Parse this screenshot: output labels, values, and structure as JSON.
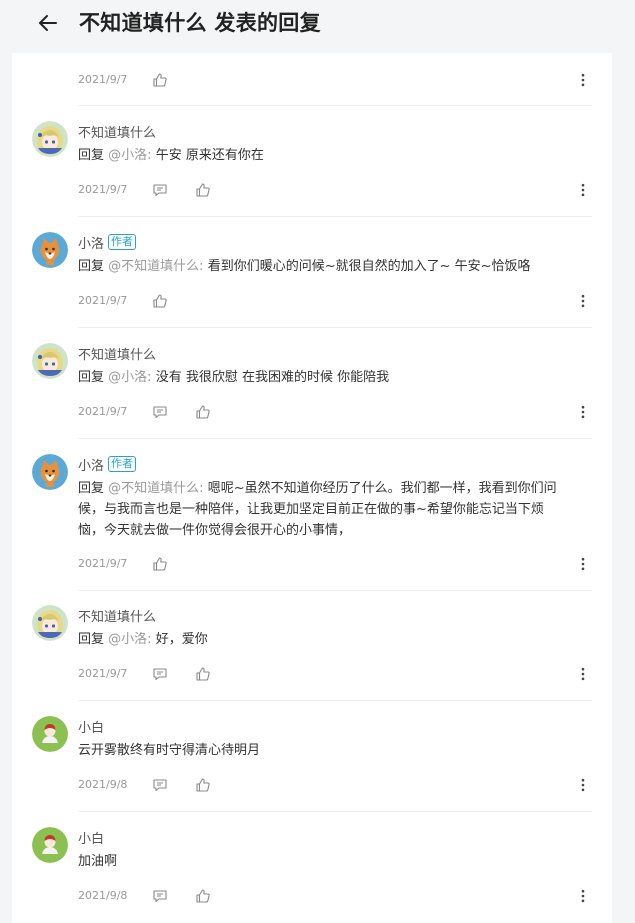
{
  "header": {
    "title": "不知道填什么 发表的回复"
  },
  "labels": {
    "reply_prefix": "回复",
    "author_badge": "作者"
  },
  "colors": {
    "page_bg": "#f4f5f7",
    "card_bg": "#ffffff",
    "badge": "#26a3c5",
    "mention": "#9a9a9a",
    "date": "#999999"
  },
  "comments": [
    {
      "id": 0,
      "partial": true,
      "date": "2021/9/7",
      "has_reply_icon": false
    },
    {
      "id": 1,
      "avatar": "anime-girl-avatar",
      "name": "不知道填什么",
      "is_author": false,
      "mention": "@小洛:",
      "text": "午安 原来还有你在",
      "date": "2021/9/7",
      "has_reply_icon": true
    },
    {
      "id": 2,
      "avatar": "shiba-dog-avatar",
      "name": "小洛",
      "is_author": true,
      "mention": "@不知道填什么:",
      "text": "看到你们暖心的问候~就很自然的加入了~ 午安~恰饭咯",
      "date": "2021/9/7",
      "has_reply_icon": false
    },
    {
      "id": 3,
      "avatar": "anime-girl-avatar",
      "name": "不知道填什么",
      "is_author": false,
      "mention": "@小洛:",
      "text": "没有 我很欣慰 在我困难的时候 你能陪我",
      "date": "2021/9/7",
      "has_reply_icon": true
    },
    {
      "id": 4,
      "avatar": "shiba-dog-avatar",
      "name": "小洛",
      "is_author": true,
      "mention": "@不知道填什么:",
      "text_lines": [
        "嗯呢~虽然不知道你经历了什么。我们都一样，我看到你们问",
        "候，与我而言也是一种陪伴，让我更加坚定目前正在做的事~希望你能忘记当下烦",
        "恼，今天就去做一件你觉得会很开心的小事情，"
      ],
      "date": "2021/9/7",
      "has_reply_icon": false
    },
    {
      "id": 5,
      "avatar": "anime-girl-avatar",
      "name": "不知道填什么",
      "is_author": false,
      "mention": "@小洛:",
      "text": "好，爱你",
      "date": "2021/9/7",
      "has_reply_icon": true
    },
    {
      "id": 6,
      "avatar": "green-avatar",
      "name": "小白",
      "is_author": false,
      "plain_text": "云开雾散终有时守得清心待明月",
      "date": "2021/9/8",
      "has_reply_icon": true
    },
    {
      "id": 7,
      "avatar": "green-avatar",
      "name": "小白",
      "is_author": false,
      "plain_text": "加油啊",
      "date": "2021/9/8",
      "has_reply_icon": true
    }
  ]
}
